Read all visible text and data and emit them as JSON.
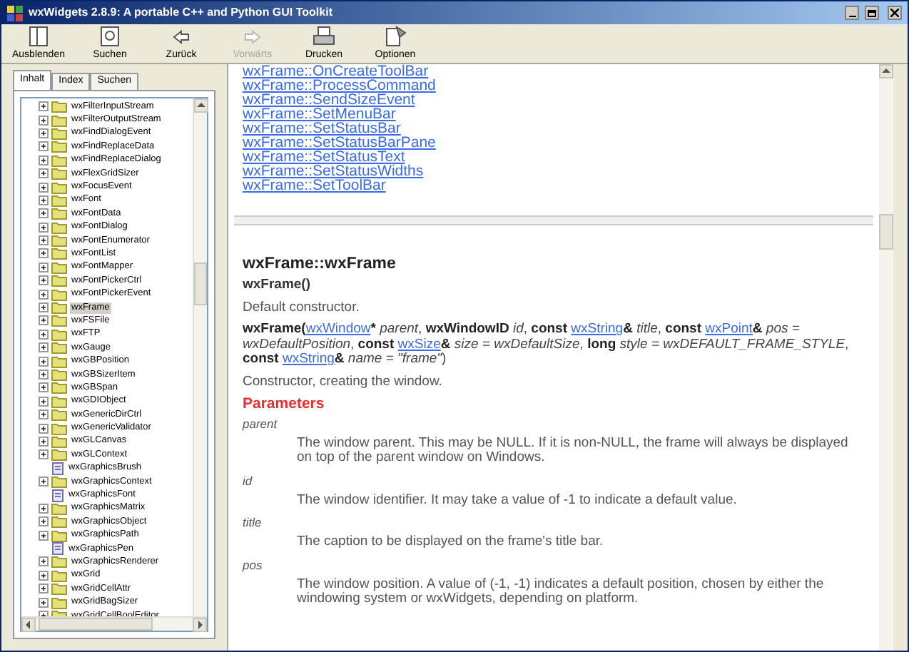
{
  "window": {
    "title": "wxWidgets 2.8.9: A portable C++ and Python GUI Toolkit"
  },
  "toolbar": [
    {
      "label": "Ausblenden",
      "disabled": false
    },
    {
      "label": "Suchen",
      "disabled": false
    },
    {
      "label": "Zurück",
      "disabled": false
    },
    {
      "label": "Vorwärts",
      "disabled": true
    },
    {
      "label": "Drucken",
      "disabled": false
    },
    {
      "label": "Optionen",
      "disabled": false
    }
  ],
  "tabs": [
    {
      "label": "Inhalt",
      "selected": true
    },
    {
      "label": "Index",
      "selected": false
    },
    {
      "label": "Suchen",
      "selected": false
    }
  ],
  "tree": [
    {
      "label": "wxFilterInputStream",
      "kind": "folder",
      "selected": false
    },
    {
      "label": "wxFilterOutputStream",
      "kind": "folder",
      "selected": false
    },
    {
      "label": "wxFindDialogEvent",
      "kind": "folder",
      "selected": false
    },
    {
      "label": "wxFindReplaceData",
      "kind": "folder",
      "selected": false
    },
    {
      "label": "wxFindReplaceDialog",
      "kind": "folder",
      "selected": false
    },
    {
      "label": "wxFlexGridSizer",
      "kind": "folder",
      "selected": false
    },
    {
      "label": "wxFocusEvent",
      "kind": "folder",
      "selected": false
    },
    {
      "label": "wxFont",
      "kind": "folder",
      "selected": false
    },
    {
      "label": "wxFontData",
      "kind": "folder",
      "selected": false
    },
    {
      "label": "wxFontDialog",
      "kind": "folder",
      "selected": false
    },
    {
      "label": "wxFontEnumerator",
      "kind": "folder",
      "selected": false
    },
    {
      "label": "wxFontList",
      "kind": "folder",
      "selected": false
    },
    {
      "label": "wxFontMapper",
      "kind": "folder",
      "selected": false
    },
    {
      "label": "wxFontPickerCtrl",
      "kind": "folder",
      "selected": false
    },
    {
      "label": "wxFontPickerEvent",
      "kind": "folder",
      "selected": false
    },
    {
      "label": "wxFrame",
      "kind": "folder",
      "selected": true
    },
    {
      "label": "wxFSFile",
      "kind": "folder",
      "selected": false
    },
    {
      "label": "wxFTP",
      "kind": "folder",
      "selected": false
    },
    {
      "label": "wxGauge",
      "kind": "folder",
      "selected": false
    },
    {
      "label": "wxGBPosition",
      "kind": "folder",
      "selected": false
    },
    {
      "label": "wxGBSizerItem",
      "kind": "folder",
      "selected": false
    },
    {
      "label": "wxGBSpan",
      "kind": "folder",
      "selected": false
    },
    {
      "label": "wxGDIObject",
      "kind": "folder",
      "selected": false
    },
    {
      "label": "wxGenericDirCtrl",
      "kind": "folder",
      "selected": false
    },
    {
      "label": "wxGenericValidator",
      "kind": "folder",
      "selected": false
    },
    {
      "label": "wxGLCanvas",
      "kind": "folder",
      "selected": false
    },
    {
      "label": "wxGLContext",
      "kind": "folder",
      "selected": false
    },
    {
      "label": "wxGraphicsBrush",
      "kind": "page",
      "selected": false
    },
    {
      "label": "wxGraphicsContext",
      "kind": "folder",
      "selected": false
    },
    {
      "label": "wxGraphicsFont",
      "kind": "page",
      "selected": false
    },
    {
      "label": "wxGraphicsMatrix",
      "kind": "folder",
      "selected": false
    },
    {
      "label": "wxGraphicsObject",
      "kind": "folder",
      "selected": false
    },
    {
      "label": "wxGraphicsPath",
      "kind": "folder",
      "selected": false
    },
    {
      "label": "wxGraphicsPen",
      "kind": "page",
      "selected": false
    },
    {
      "label": "wxGraphicsRenderer",
      "kind": "folder",
      "selected": false
    },
    {
      "label": "wxGrid",
      "kind": "folder",
      "selected": false
    },
    {
      "label": "wxGridCellAttr",
      "kind": "folder",
      "selected": false
    },
    {
      "label": "wxGridBagSizer",
      "kind": "folder",
      "selected": false
    },
    {
      "label": "wxGridCellBoolEditor",
      "kind": "folder",
      "selected": false
    }
  ],
  "links": [
    "wxFrame::OnCreateToolBar",
    "wxFrame::ProcessCommand",
    "wxFrame::SendSizeEvent",
    "wxFrame::SetMenuBar",
    "wxFrame::SetStatusBar",
    "wxFrame::SetStatusBarPane",
    "wxFrame::SetStatusText",
    "wxFrame::SetStatusWidths",
    "wxFrame::SetToolBar"
  ],
  "heading": "wxFrame::wxFrame",
  "signature_1": "wxFrame()",
  "description_1": "Default constructor.",
  "signature_2": [
    {
      "kind": "bold",
      "text": "wxFrame("
    },
    {
      "kind": "link",
      "text": "wxWindow"
    },
    {
      "kind": "bold",
      "text": "* "
    },
    {
      "kind": "italic",
      "text": "parent"
    },
    {
      "kind": "text",
      "text": ", "
    },
    {
      "kind": "bold",
      "text": "wxWindowID "
    },
    {
      "kind": "italic",
      "text": "id"
    },
    {
      "kind": "text",
      "text": ", "
    },
    {
      "kind": "bold",
      "text": "const "
    },
    {
      "kind": "link",
      "text": "wxString"
    },
    {
      "kind": "bold",
      "text": "& "
    },
    {
      "kind": "italic",
      "text": "title"
    },
    {
      "kind": "text",
      "text": ", "
    },
    {
      "kind": "bold",
      "text": "const "
    },
    {
      "kind": "link",
      "text": "wxPoint"
    },
    {
      "kind": "bold",
      "text": "& "
    },
    {
      "kind": "italic",
      "text": "pos = wxDefaultPosition"
    },
    {
      "kind": "text",
      "text": ", "
    },
    {
      "kind": "bold",
      "text": "const "
    },
    {
      "kind": "link",
      "text": "wxSize"
    },
    {
      "kind": "bold",
      "text": "& "
    },
    {
      "kind": "italic",
      "text": "size = wxDefaultSize"
    },
    {
      "kind": "text",
      "text": ", "
    },
    {
      "kind": "bold",
      "text": "long "
    },
    {
      "kind": "italic",
      "text": "style = wxDEFAULT_FRAME_STYLE"
    },
    {
      "kind": "text",
      "text": ", "
    },
    {
      "kind": "bold",
      "text": "const "
    },
    {
      "kind": "link",
      "text": "wxString"
    },
    {
      "kind": "bold",
      "text": "& "
    },
    {
      "kind": "italic",
      "text": "name = \"frame\""
    },
    {
      "kind": "text",
      "text": ")"
    }
  ],
  "description_2": "Constructor, creating the window.",
  "parameters_heading": "Parameters",
  "parameters": [
    {
      "name": "parent",
      "text": "The window parent. This may be NULL. If it is non-NULL, the frame will always be displayed on top of the parent window on Windows."
    },
    {
      "name": "id",
      "text": "The window identifier. It may take a value of -1 to indicate a default value."
    },
    {
      "name": "title",
      "text": "The caption to be displayed on the frame's title bar."
    },
    {
      "name": "pos",
      "text": "The window position. A value of (-1, -1) indicates a default position, chosen by either the windowing system or wxWidgets, depending on platform."
    }
  ]
}
